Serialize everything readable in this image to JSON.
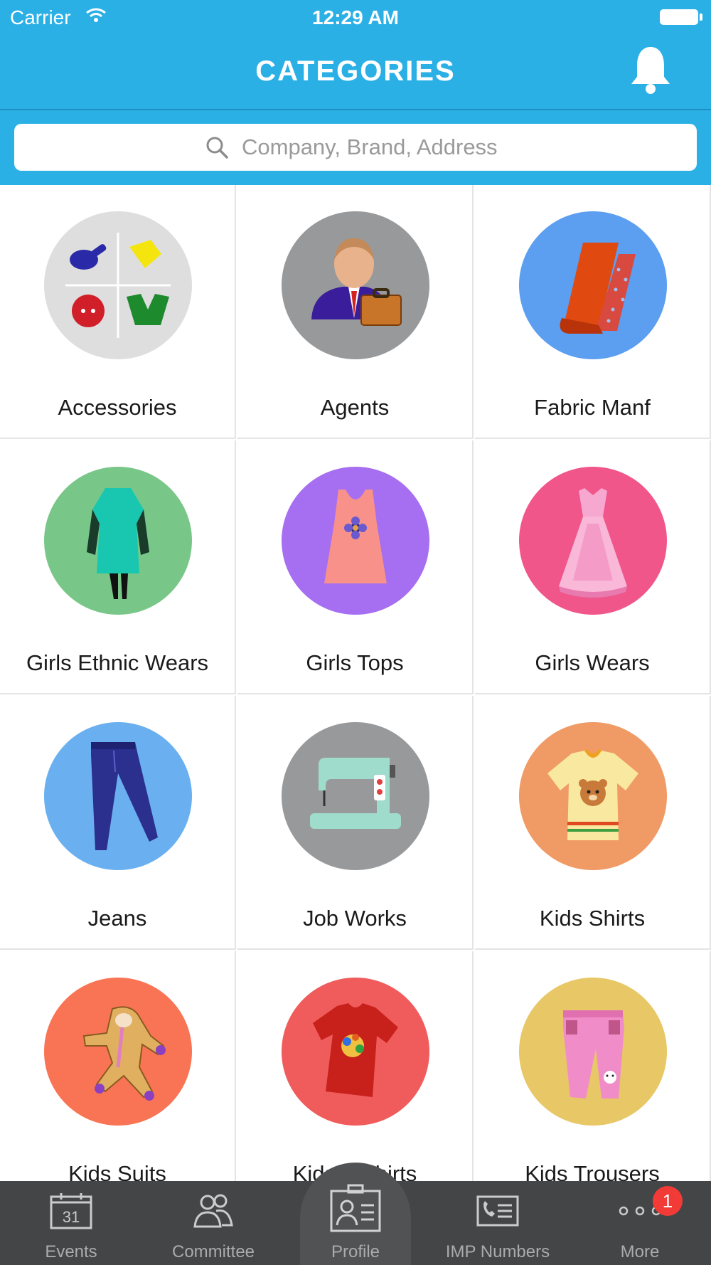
{
  "status_bar": {
    "carrier": "Carrier",
    "time": "12:29 AM"
  },
  "header": {
    "title": "CATEGORIES"
  },
  "search": {
    "placeholder": "Company, Brand, Address"
  },
  "categories": [
    {
      "label": "Accessories",
      "color": "#dedede"
    },
    {
      "label": "Agents",
      "color": "#98999b"
    },
    {
      "label": "Fabric Manf",
      "color": "#5c9ef0"
    },
    {
      "label": "Girls Ethnic Wears",
      "color": "#79c788"
    },
    {
      "label": "Girls Tops",
      "color": "#a66ef0"
    },
    {
      "label": "Girls Wears",
      "color": "#f0568a"
    },
    {
      "label": "Jeans",
      "color": "#6ab0f0"
    },
    {
      "label": "Job Works",
      "color": "#98999b"
    },
    {
      "label": "Kids Shirts",
      "color": "#f09a66"
    },
    {
      "label": "Kids Suits",
      "color": "#f97455"
    },
    {
      "label": "Kids T Shirts",
      "color": "#f05c5c"
    },
    {
      "label": "Kids Trousers",
      "color": "#e8c766"
    }
  ],
  "tabbar": {
    "items": [
      {
        "label": "Events"
      },
      {
        "label": "Committee"
      },
      {
        "label": "Profile"
      },
      {
        "label": "IMP Numbers"
      },
      {
        "label": "More"
      }
    ],
    "badge": "1",
    "calendar_day": "31"
  }
}
